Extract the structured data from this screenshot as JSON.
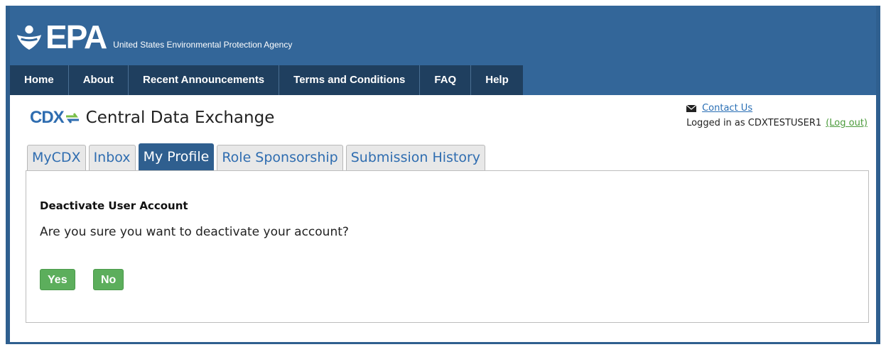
{
  "header": {
    "logo_text": "EPA",
    "agency_name": "United States Environmental Protection Agency",
    "brand_color": "#336699"
  },
  "nav": {
    "items": [
      {
        "label": "Home"
      },
      {
        "label": "About"
      },
      {
        "label": "Recent Announcements"
      },
      {
        "label": "Terms and Conditions"
      },
      {
        "label": "FAQ"
      },
      {
        "label": "Help"
      }
    ]
  },
  "app": {
    "logo_text": "CDX",
    "title": "Central Data Exchange"
  },
  "user": {
    "contact_label": "Contact Us",
    "logged_in_text": "Logged in as CDXTESTUSER1",
    "logout_label": "(Log out)",
    "mail_icon": "envelope-icon"
  },
  "tabs": [
    {
      "label": "MyCDX",
      "active": false
    },
    {
      "label": "Inbox",
      "active": false
    },
    {
      "label": "My Profile",
      "active": true
    },
    {
      "label": "Role Sponsorship",
      "active": false
    },
    {
      "label": "Submission History",
      "active": false
    }
  ],
  "dialog": {
    "heading": "Deactivate User Account",
    "question": "Are you sure you want to deactivate your account?",
    "yes_label": "Yes",
    "no_label": "No",
    "button_color": "#5cae5c"
  }
}
